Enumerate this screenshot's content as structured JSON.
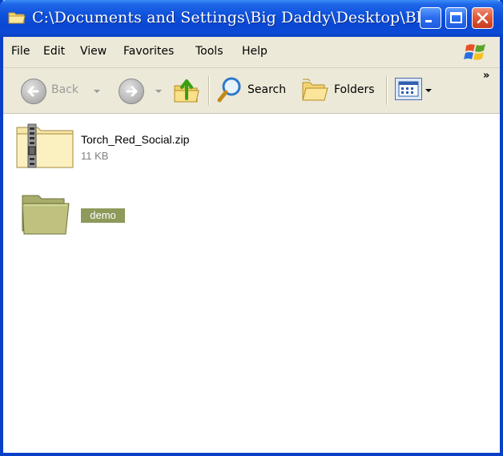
{
  "window": {
    "title": "C:\\Documents and Settings\\Big Daddy\\Desktop\\Bl..."
  },
  "menu": {
    "items": [
      {
        "label": "File"
      },
      {
        "label": "Edit"
      },
      {
        "label": "View"
      },
      {
        "label": "Favorites"
      },
      {
        "label": "Tools"
      },
      {
        "label": "Help"
      }
    ]
  },
  "toolbar": {
    "back_label": "Back",
    "search_label": "Search",
    "folders_label": "Folders",
    "overflow": "»"
  },
  "files": [
    {
      "name": "Torch_Red_Social.zip",
      "size": "11 KB",
      "icon": "zip-folder-icon"
    },
    {
      "name": "demo",
      "icon": "folder-icon",
      "selected": true
    }
  ],
  "colors": {
    "title_bar": "#0a47d2",
    "chrome": "#ece9d8",
    "selection": "#8c9a5a",
    "close_button": "#e05a3c"
  }
}
